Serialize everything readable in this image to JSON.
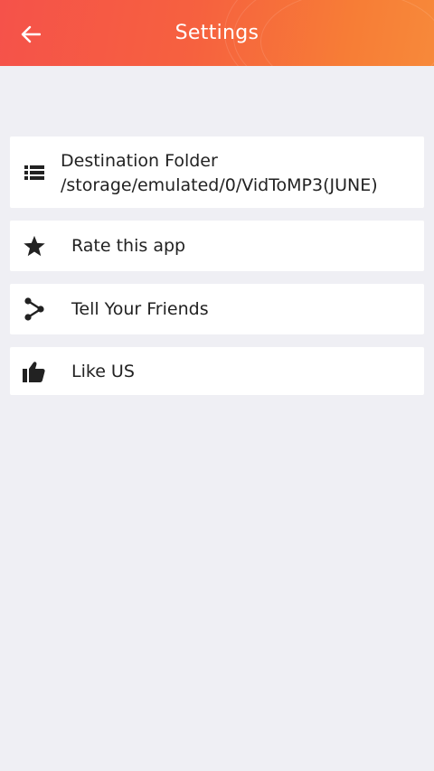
{
  "header": {
    "title": "Settings",
    "back_icon": "arrow-left-icon",
    "gradient_start": "#f5524a",
    "gradient_end": "#f7893a"
  },
  "settings": {
    "destination": {
      "label": "Destination Folder",
      "path": "/storage/emulated/0/VidToMP3(JUNE)",
      "icon": "list-icon"
    },
    "rate": {
      "label": "Rate this app",
      "icon": "star-icon"
    },
    "tell": {
      "label": "Tell Your Friends",
      "icon": "share-icon"
    },
    "like": {
      "label": "Like US",
      "icon": "thumbs-up-icon"
    }
  }
}
